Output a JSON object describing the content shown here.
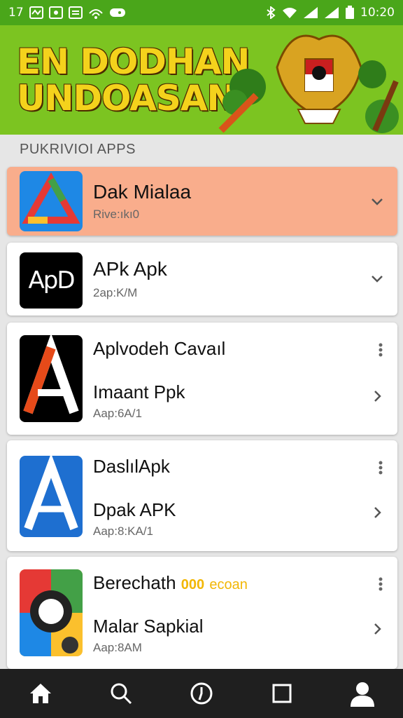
{
  "status_bar": {
    "left_number": "17",
    "time": "10:20"
  },
  "banner": {
    "line1": "EN DODHAN",
    "line2": "UNDOASAN"
  },
  "section": {
    "label": "PUKRIVIOI APPS"
  },
  "apps": [
    {
      "title": "Dak Mialaa",
      "subtitle": "Rive:ıkı0",
      "action": "chevron-down"
    },
    {
      "title": "APk Apk",
      "subtitle": "2ap:K/M",
      "icon_text": "ApD",
      "action": "chevron-down"
    },
    {
      "title": "Aplvodeh Cavaıl",
      "line2": "Imaant Ppk",
      "subtitle": "Aap:6A/1",
      "action": "chevron-right"
    },
    {
      "title": "DaslılApk",
      "line2": "Dpak APK",
      "subtitle": "Aap:8:KA/1",
      "action": "chevron-right"
    },
    {
      "title": "Berechath",
      "badge": "000",
      "badge_text": "ecoan",
      "line2": "Malar Sapkial",
      "subtitle": "Aap:8AM",
      "action": "chevron-right"
    }
  ],
  "colors": {
    "status_green": "#4aa61a",
    "banner_green": "#7cc421",
    "highlight": "#f9ad8c",
    "nav_bg": "#1f1f1f"
  },
  "nav": [
    "home-icon",
    "search-icon",
    "clock-icon",
    "square-icon",
    "profile-icon"
  ]
}
